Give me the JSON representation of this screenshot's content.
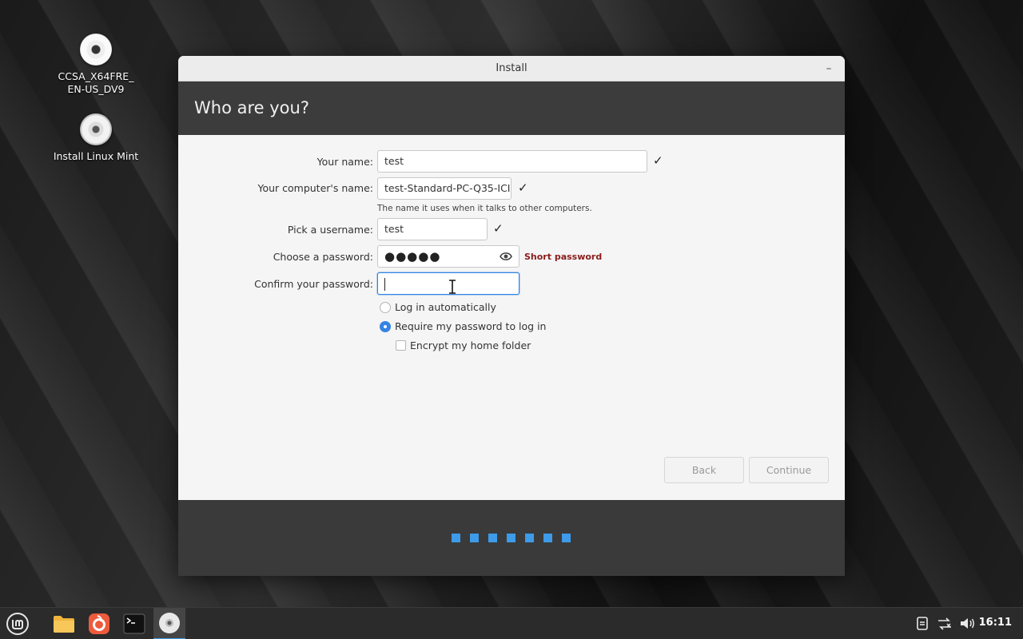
{
  "desktop": {
    "icons": [
      {
        "label_line1": "CCSA_X64FRE_",
        "label_line2": "EN-US_DV9",
        "icon": "disc-icon"
      },
      {
        "label_line1": "Install Linux Mint",
        "icon": "install-disc-icon"
      }
    ]
  },
  "window": {
    "title": "Install",
    "minimize": "–",
    "heading": "Who are you?"
  },
  "form": {
    "name_label": "Your name:",
    "name_value": "test",
    "computer_label": "Your computer's name:",
    "computer_value": "test-Standard-PC-Q35-ICI",
    "computer_hint": "The name it uses when it talks to other computers.",
    "username_label": "Pick a username:",
    "username_value": "test",
    "password_label": "Choose a password:",
    "password_value": "●●●●●",
    "password_strength": "Short password",
    "confirm_label": "Confirm your password:",
    "confirm_value": "",
    "check_mark": "✓",
    "login_auto": "Log in automatically",
    "login_require": "Require my password to log in",
    "encrypt_home": "Encrypt my home folder",
    "selected_login_option": "Require my password to log in"
  },
  "buttons": {
    "back": "Back",
    "continue": "Continue"
  },
  "progress": {
    "total_steps": 7
  },
  "taskbar": {
    "clock": "16:11"
  },
  "colors": {
    "accent": "#3584e4",
    "progress": "#3d9be9",
    "warning": "#8a1c1c"
  }
}
